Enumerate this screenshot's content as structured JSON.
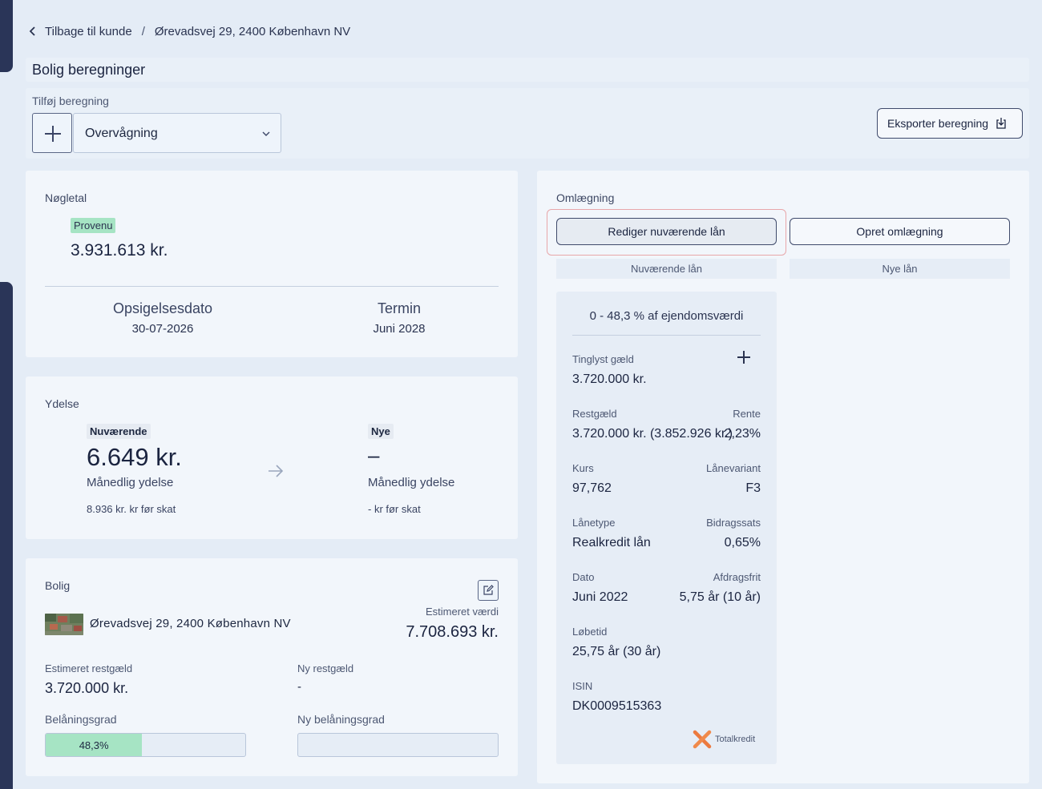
{
  "breadcrumb": {
    "back_label": "Tilbage til kunde",
    "separator": "/",
    "current": "Ørevadsvej 29, 2400 København NV"
  },
  "page_title": "Bolig beregninger",
  "add_calc": {
    "label": "Tilføj beregning",
    "selected": "Overvågning",
    "export_label": "Eksporter beregning"
  },
  "nogletal": {
    "title": "Nøgletal",
    "provenu_tag": "Provenu",
    "provenu_value": "3.931.613 kr.",
    "opsigelse_label": "Opsigelsesdato",
    "opsigelse_value": "30-07-2026",
    "termin_label": "Termin",
    "termin_value": "Juni 2028"
  },
  "ydelse": {
    "title": "Ydelse",
    "current_tag": "Nuværende",
    "current_value": "6.649 kr.",
    "current_sub": "Månedlig ydelse",
    "current_pretax": "8.936 kr. kr før skat",
    "new_tag": "Nye",
    "new_value": "–",
    "new_sub": "Månedlig ydelse",
    "new_pretax": "- kr før skat"
  },
  "bolig": {
    "title": "Bolig",
    "address": "Ørevadsvej 29, 2400 København NV",
    "est_value_label": "Estimeret værdi",
    "est_value": "7.708.693 kr.",
    "est_rest_label": "Estimeret restgæld",
    "est_rest_value": "3.720.000 kr.",
    "new_rest_label": "Ny restgæld",
    "new_rest_value": "-",
    "ltv_label": "Belåningsgrad",
    "ltv_value": "48,3%",
    "ltv_fraction": 0.483,
    "new_ltv_label": "Ny belåningsgrad"
  },
  "omlaegning": {
    "title": "Omlægning",
    "edit_button": "Rediger nuværende lån",
    "create_button": "Opret omlægning",
    "current_header": "Nuværende lån",
    "new_header": "Nye lån",
    "loan": {
      "range": "0 - 48,3 % af ejendomsværdi",
      "tinglyst_label": "Tinglyst gæld",
      "tinglyst_value": "3.720.000 kr.",
      "restgaeld_label": "Restgæld",
      "restgaeld_value": "3.720.000 kr. (3.852.926 kr.)",
      "rente_label": "Rente",
      "rente_value": "2,23%",
      "kurs_label": "Kurs",
      "kurs_value": "97,762",
      "variant_label": "Lånevariant",
      "variant_value": "F3",
      "type_label": "Lånetype",
      "type_value": "Realkredit lån",
      "bidrag_label": "Bidragssats",
      "bidrag_value": "0,65%",
      "dato_label": "Dato",
      "dato_value": "Juni 2022",
      "afdrag_label": "Afdragsfrit",
      "afdrag_value": "5,75 år (10 år)",
      "lobetid_label": "Løbetid",
      "lobetid_value": "25,75 år (30 år)",
      "isin_label": "ISIN",
      "isin_value": "DK0009515363",
      "lender": "Totalkredit"
    }
  },
  "colors": {
    "background": "#e4ecf6",
    "card": "#f2f6fb",
    "sidebar": "#2a3558",
    "accent_green": "#a6e4c4",
    "focus_ring": "#e8a7aa"
  }
}
